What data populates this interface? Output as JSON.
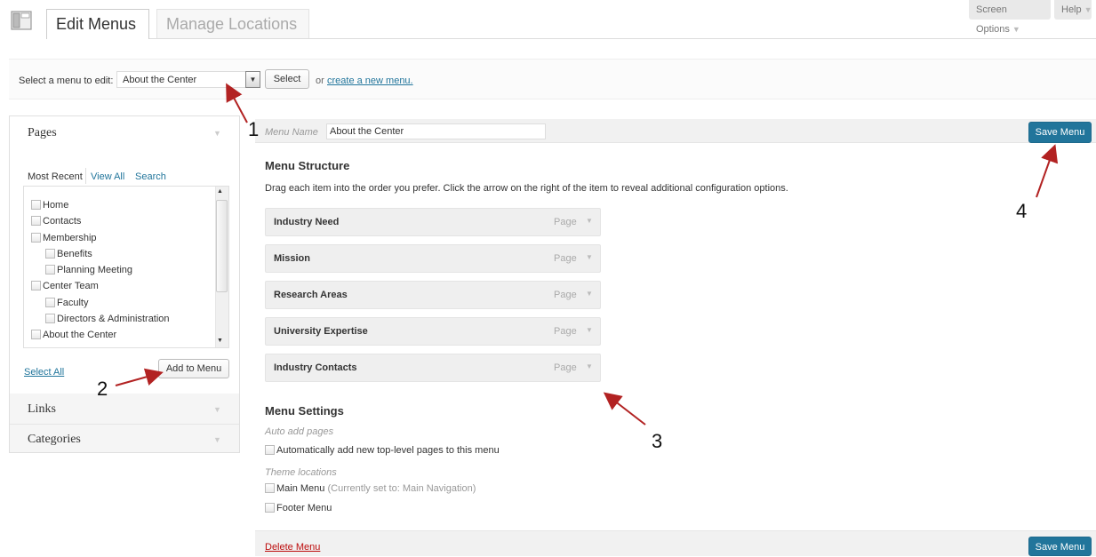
{
  "header": {
    "tabs": [
      {
        "label": "Edit Menus"
      },
      {
        "label": "Manage Locations"
      }
    ],
    "screen_options": "Screen Options",
    "help": "Help"
  },
  "select_bar": {
    "label": "Select a menu to edit:",
    "selected": "About the Center",
    "select_button": "Select",
    "or_text": "or",
    "create_link": "create a new menu."
  },
  "left_panel": {
    "pages": {
      "title": "Pages",
      "tabs": [
        "Most Recent",
        "View All",
        "Search"
      ],
      "items": [
        {
          "label": "Home",
          "level": 0
        },
        {
          "label": "Contacts",
          "level": 0
        },
        {
          "label": "Membership",
          "level": 0
        },
        {
          "label": "Benefits",
          "level": 1
        },
        {
          "label": "Planning Meeting",
          "level": 1
        },
        {
          "label": "Center Team",
          "level": 0
        },
        {
          "label": "Faculty",
          "level": 1
        },
        {
          "label": "Directors & Administration",
          "level": 1
        },
        {
          "label": "About the Center",
          "level": 0
        }
      ],
      "select_all": "Select All",
      "add_button": "Add to Menu"
    },
    "links_title": "Links",
    "categories_title": "Categories"
  },
  "menu": {
    "name_label": "Menu Name",
    "name_value": "About the Center",
    "save_label": "Save Menu",
    "structure_title": "Menu Structure",
    "structure_desc": "Drag each item into the order you prefer. Click the arrow on the right of the item to reveal additional configuration options.",
    "items": [
      {
        "title": "Industry Need",
        "type": "Page"
      },
      {
        "title": "Mission",
        "type": "Page"
      },
      {
        "title": "Research Areas",
        "type": "Page"
      },
      {
        "title": "University Expertise",
        "type": "Page"
      },
      {
        "title": "Industry Contacts",
        "type": "Page"
      }
    ],
    "settings": {
      "title": "Menu Settings",
      "auto_add_label": "Auto add pages",
      "auto_add_option": "Automatically add new top-level pages to this menu",
      "theme_locations_label": "Theme locations",
      "main_menu": "Main Menu",
      "main_menu_note": "(Currently set to: Main Navigation)",
      "footer_menu": "Footer Menu"
    },
    "delete_label": "Delete Menu"
  },
  "annotations": [
    "1",
    "2",
    "3",
    "4"
  ],
  "colors": {
    "accent": "#21759b",
    "annotation_arrow": "#b22222",
    "delete": "#bc0b0b"
  }
}
